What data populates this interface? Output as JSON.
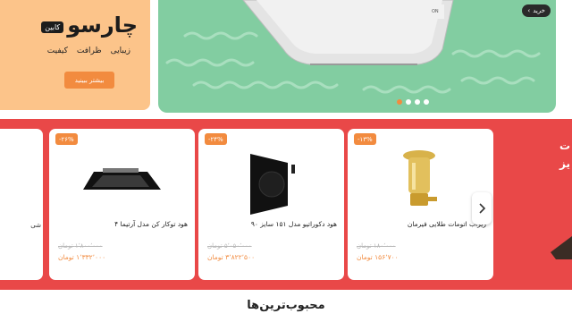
{
  "promo": {
    "brand_main": "چارسو",
    "brand_badge": "کابین",
    "tags": [
      "کیفیت",
      "ظرافت",
      "زیبایی"
    ],
    "cta_label": "بیشتر ببینید"
  },
  "hero": {
    "buy_label": "خرید",
    "active_slide": 1,
    "slide_count": 4
  },
  "products": [
    {
      "title": "زیرآب اتومات طلایی فیرمان",
      "discount": "-۱۳%",
      "old_price": "۱۸۰٬۰۰۰ تومان",
      "new_price": "۱۵۶٬۷۰۰ تومان"
    },
    {
      "title": "هود دکوراتیو مدل ۱۵۱ سایز ۹۰",
      "discount": "-۲۴%",
      "old_price": "۵٬۰۵۰٬۰۰۰ تومان",
      "new_price": "۳٬۸۲۲٬۵۰۰ تومان"
    },
    {
      "title": "هود توکار کن مدل آرتیما ۴",
      "discount": "-۲۶%",
      "old_price": "۱٬۸۰۰٬۰۰۰ تومان",
      "new_price": "۱٬۳۳۲٬۰۰۰ تومان"
    }
  ],
  "side_text": [
    "ت",
    "یز"
  ],
  "left_edge_text": "شی",
  "section_title": "محبوب‌ترین‌ها",
  "colors": {
    "accent": "#f28b3f",
    "strip": "#e94848",
    "hero_bg": "#82cda1",
    "promo_bg": "#fcc48a"
  }
}
